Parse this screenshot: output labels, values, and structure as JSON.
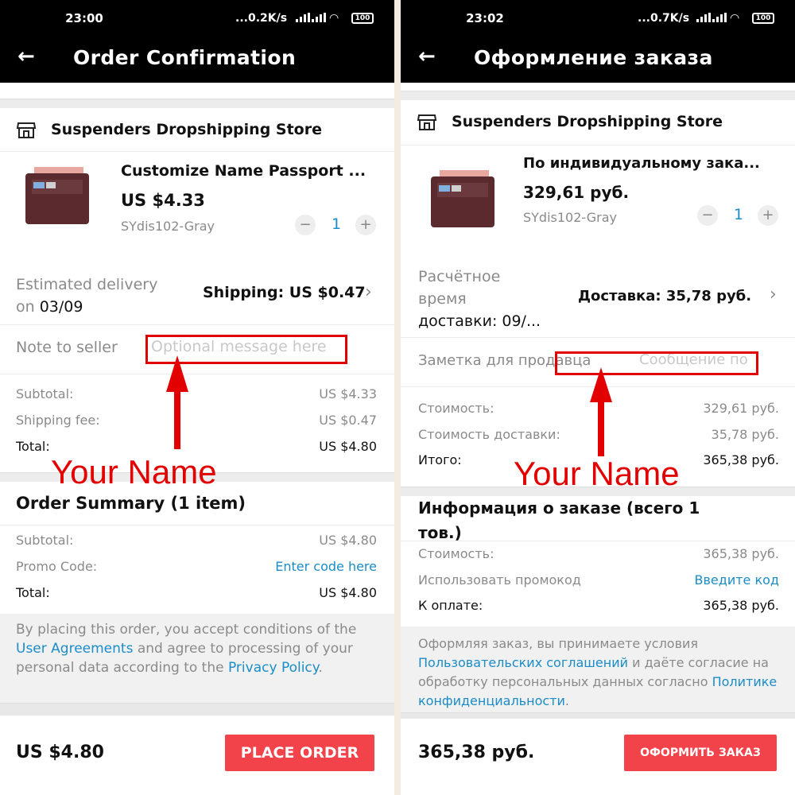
{
  "left": {
    "status": {
      "time": "23:00",
      "net": "...0.2K/s",
      "battery": "100"
    },
    "title": "Order Confirmation",
    "store_name": "Suspenders Dropshipping Store",
    "product": {
      "title": "Customize Name Passport ...",
      "price": "US $4.33",
      "variant": "SYdis102-Gray",
      "qty": "1",
      "minus": "−",
      "plus": "+"
    },
    "delivery": {
      "label_line1": "Estimated delivery",
      "label_line2_prefix": "on ",
      "label_date": "03/09",
      "shipping": "Shipping: US $0.47"
    },
    "note": {
      "label": "Note to seller",
      "placeholder": "Optional message here"
    },
    "costs": [
      {
        "label": "Subtotal:",
        "value": "US $4.33"
      },
      {
        "label": "Shipping fee:",
        "value": "US $0.47"
      },
      {
        "label": "Total:",
        "value": "US $4.80"
      }
    ],
    "summary_title": "Order Summary (1 item)",
    "summary": {
      "subtotal_label": "Subtotal:",
      "subtotal_value": "US $4.80",
      "promo_label": "Promo Code:",
      "promo_link": "Enter code here",
      "total_label": "Total:",
      "total_value": "US $4.80"
    },
    "terms": {
      "t1": "By placing this order, you accept conditions of the ",
      "l1": "User Agreements",
      "t2": " and agree to processing of your personal data according to the ",
      "l2": "Privacy Policy",
      "t3": "."
    },
    "bottom_total": "US $4.80",
    "place_order": "PLACE ORDER",
    "annotation": "Your Name"
  },
  "right": {
    "status": {
      "time": "23:02",
      "net": "...0.7K/s",
      "battery": "100"
    },
    "title": "Оформление заказа",
    "store_name": "Suspenders Dropshipping Store",
    "product": {
      "title": "По индивидуальному зака...",
      "price": "329,61 руб.",
      "variant": "SYdis102-Gray",
      "qty": "1",
      "minus": "−",
      "plus": "+"
    },
    "delivery": {
      "label_line1": "Расчётное",
      "label_line2": "время",
      "label_line3": "доставки: 09/...",
      "shipping": "Доставка: 35,78 руб."
    },
    "note": {
      "label": "Заметка для продавца",
      "placeholder": "Сообщение по"
    },
    "costs": [
      {
        "label": "Стоимость:",
        "value": "329,61 руб."
      },
      {
        "label": "Стоимость доставки:",
        "value": "35,78 руб."
      },
      {
        "label": "Итого:",
        "value": "365,38 руб."
      }
    ],
    "summary_title_1": "Информация о заказе (всего 1",
    "summary_title_2": "тов.)",
    "summary": {
      "subtotal_label": "Стоимость:",
      "subtotal_value": "365,38 руб.",
      "promo_label": "Использовать промокод",
      "promo_link": "Введите код",
      "total_label": "К оплате:",
      "total_value": "365,38 руб."
    },
    "terms": {
      "t1": "Оформляя заказ, вы принимаете условия ",
      "l1": "Пользовательских соглашений",
      "t2": " и даёте согласие на обработку персональных данных согласно ",
      "l2": "Политике конфиденциальности",
      "t3": "."
    },
    "bottom_total": "365,38 руб.",
    "place_order": "ОФОРМИТЬ ЗАКАЗ",
    "annotation": "Your Name"
  },
  "colors": {
    "accent": "#f2424a",
    "link": "#1a8cc7",
    "annotation": "#e30000"
  },
  "icons": [
    "back-arrow-icon",
    "store-icon",
    "chevron-right-icon",
    "signal-icon",
    "wifi-icon",
    "battery-icon"
  ]
}
